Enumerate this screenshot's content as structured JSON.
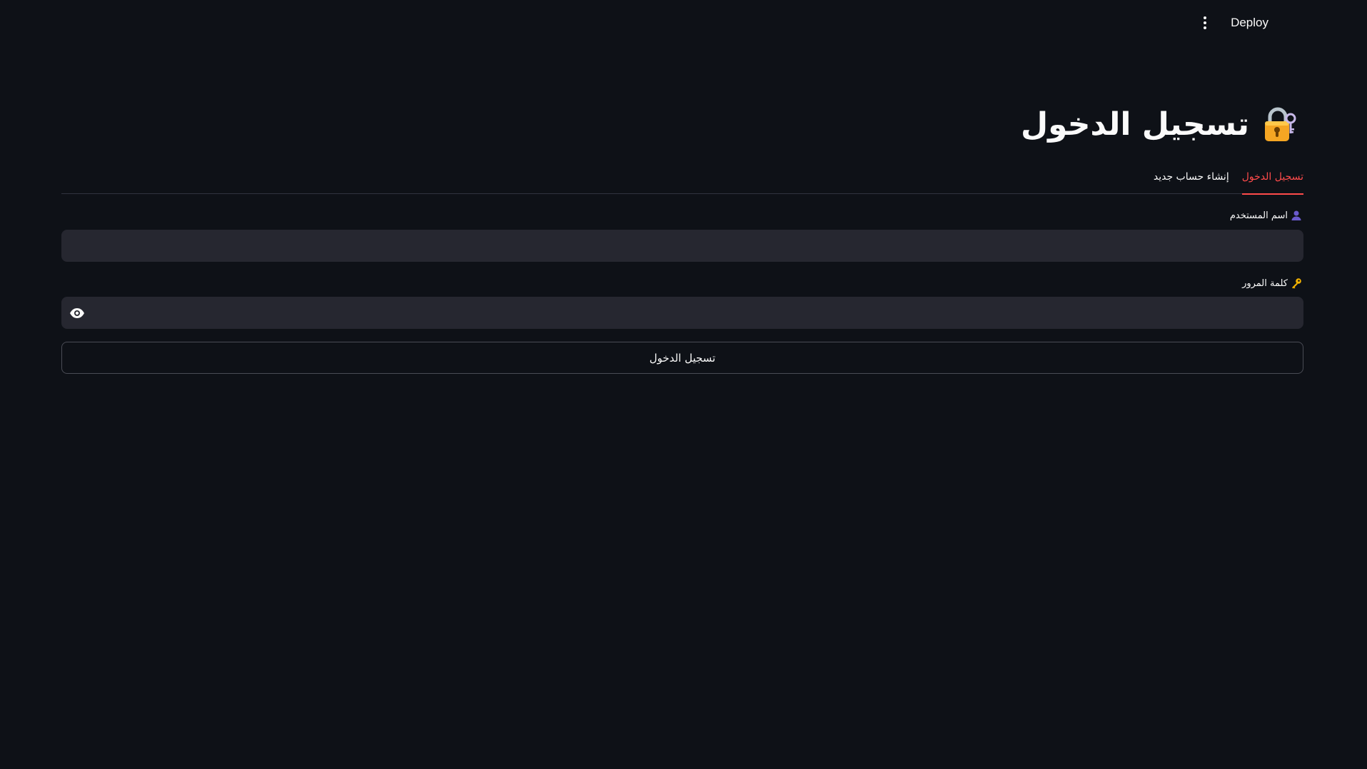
{
  "header": {
    "deploy_label": "Deploy",
    "menu_icon": "kebab-menu-icon"
  },
  "page": {
    "title": "تسجيل الدخول",
    "title_icon": "locked-with-key-icon"
  },
  "tabs": [
    {
      "label": "تسجيل الدخول",
      "active": true
    },
    {
      "label": "إنشاء حساب جديد",
      "active": false
    }
  ],
  "form": {
    "username": {
      "label": "اسم المستخدم",
      "icon": "user-silhouette-icon",
      "value": ""
    },
    "password": {
      "label": "كلمة المرور",
      "icon": "key-icon",
      "value": "",
      "toggle_icon": "eye-icon"
    },
    "submit_label": "تسجيل الدخول"
  },
  "colors": {
    "background": "#0e1117",
    "input_bg": "#262730",
    "accent": "#ff4b4b",
    "text": "#fafafa"
  }
}
